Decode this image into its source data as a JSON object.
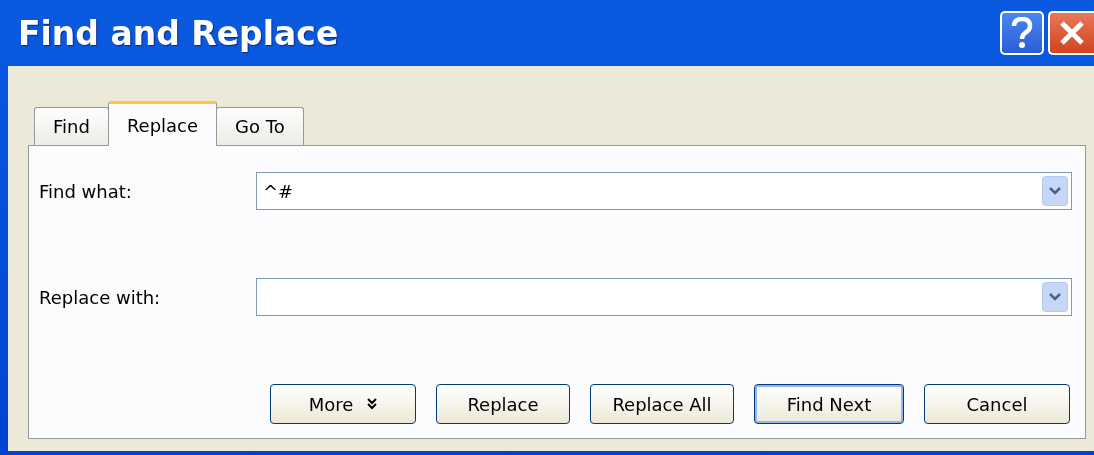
{
  "window": {
    "title": "Find and Replace"
  },
  "tabs": [
    {
      "label": "Find",
      "selected": false
    },
    {
      "label": "Replace",
      "selected": true
    },
    {
      "label": "Go To",
      "selected": false
    }
  ],
  "fields": [
    {
      "label": "Find what:",
      "value": "^#"
    },
    {
      "label": "Replace with:"
    }
  ],
  "buttons": [
    {
      "label": "More",
      "kind": "expand",
      "default": false
    },
    {
      "label": "Replace",
      "kind": "plain",
      "default": false
    },
    {
      "label": "Replace All",
      "kind": "plain",
      "default": false
    },
    {
      "label": "Find Next",
      "kind": "plain",
      "default": true
    },
    {
      "label": "Cancel",
      "kind": "plain",
      "default": false
    }
  ]
}
